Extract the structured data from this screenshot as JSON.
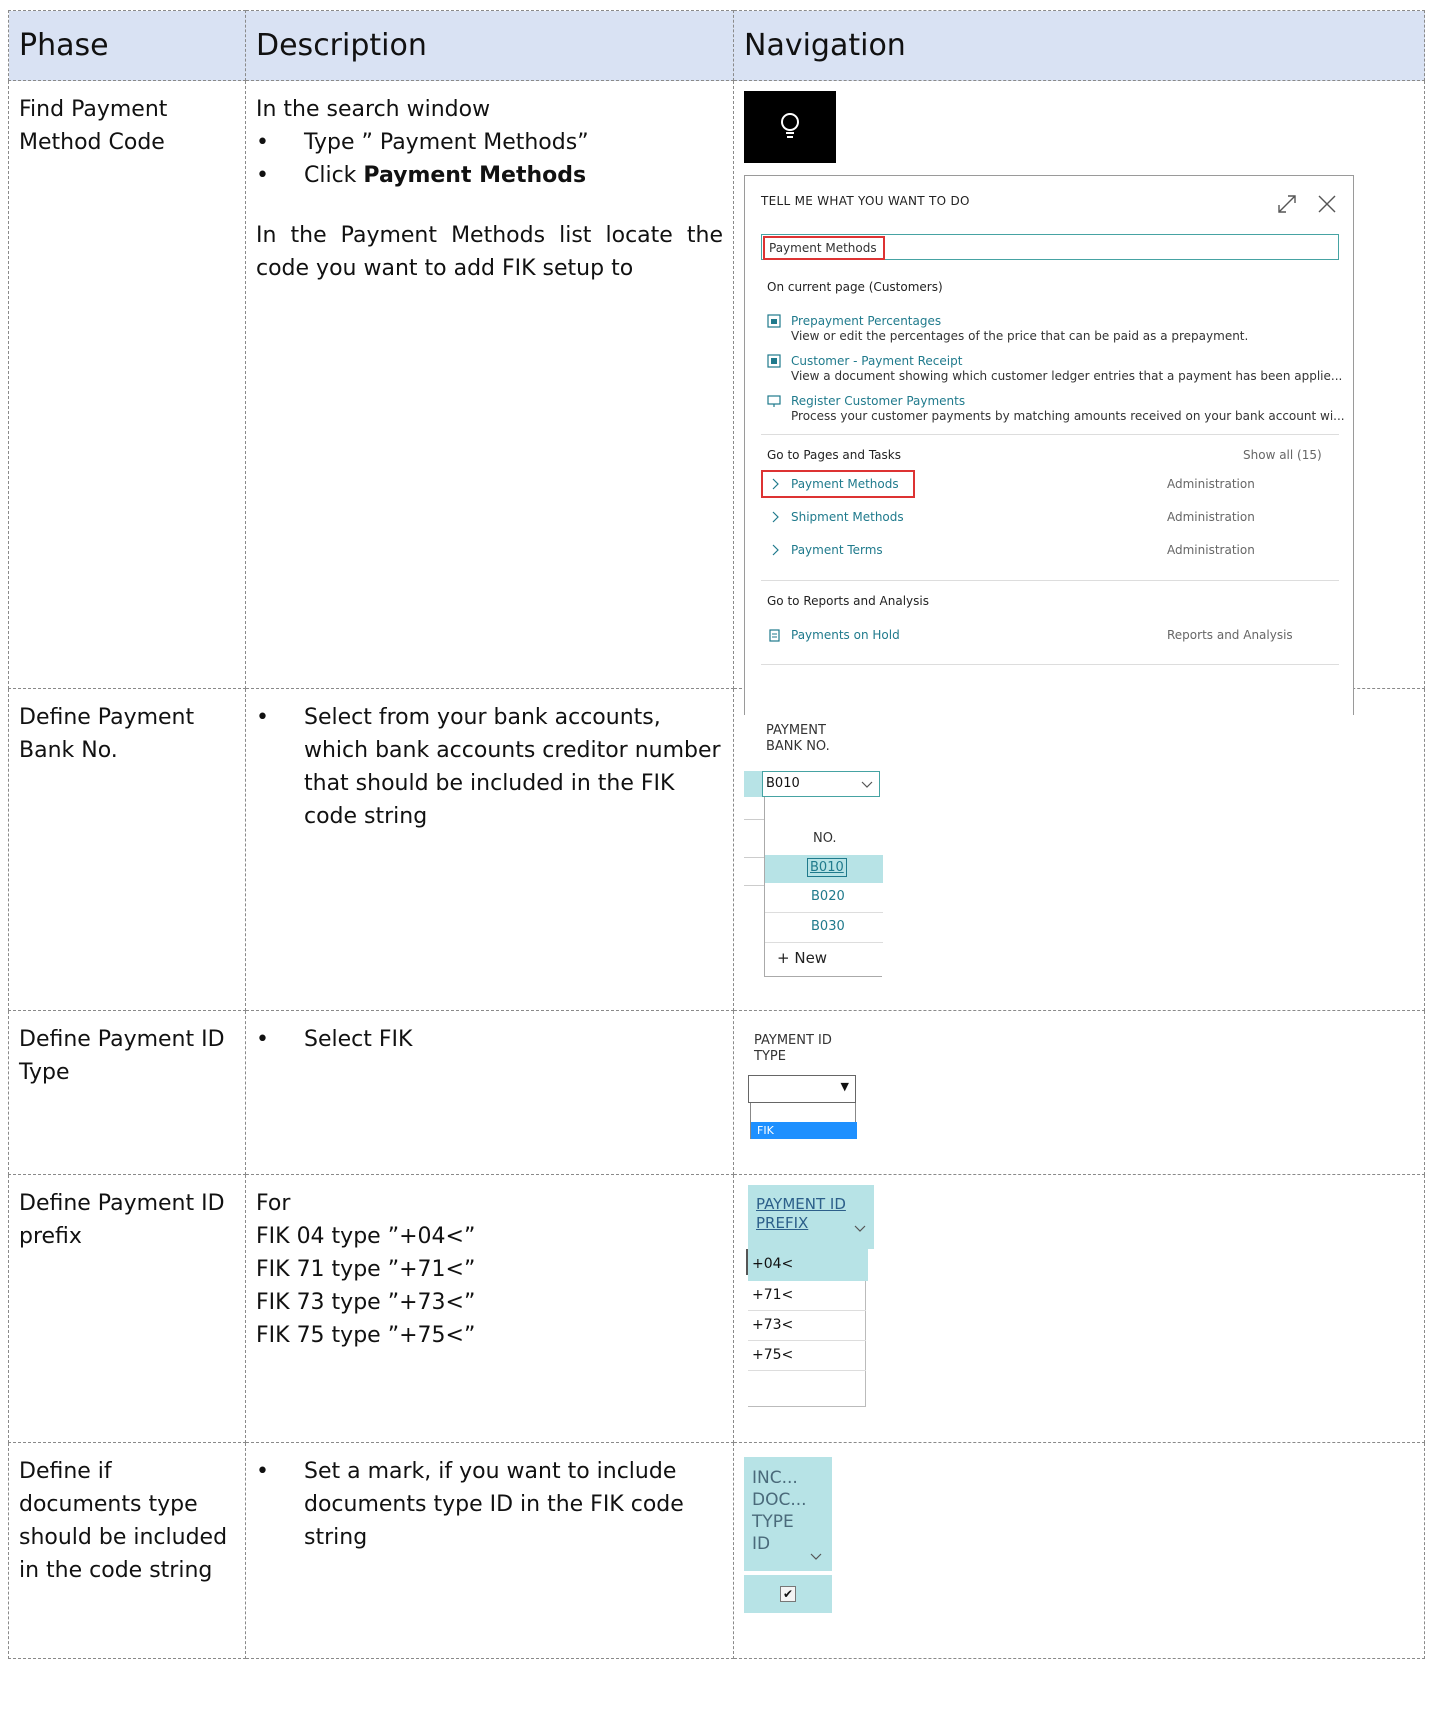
{
  "table": {
    "headers": {
      "phase": "Phase",
      "description": "Description",
      "navigation": "Navigation"
    },
    "rows": [
      {
        "phase": "Find Payment Method Code",
        "intro": "In the search window",
        "bullets": [
          "Type ” Payment Methods”"
        ],
        "bullet_click_prefix": "Click ",
        "bullet_click_bold": "Payment Methods",
        "para": "In the Payment Methods list locate the code you want to add FIK setup to"
      },
      {
        "phase": "Define Payment Bank No.",
        "bullets": [
          "Select from your bank accounts, which bank accounts creditor number that should be included in the FIK code string"
        ]
      },
      {
        "phase": "Define Payment ID Type",
        "bullets": [
          "Select FIK"
        ]
      },
      {
        "phase": "Define Payment ID prefix",
        "lines": [
          "For",
          "FIK 04 type ”+04<”",
          "FIK 71 type ”+71<”",
          "FIK 73 type ”+73<”",
          "FIK 75 type ”+75<”"
        ]
      },
      {
        "phase": "Define if documents type should be included in the code string",
        "bullets": [
          "Set a mark, if you want to include documents type ID in the FIK code string"
        ]
      }
    ]
  },
  "search_panel": {
    "title": "TELL ME WHAT YOU WANT TO DO",
    "search_value": "Payment Methods",
    "section_current": "On current page (Customers)",
    "current_items": [
      {
        "title": "Prepayment Percentages",
        "desc": "View or edit the percentages of the price that can be paid as a prepayment."
      },
      {
        "title": "Customer - Payment Receipt",
        "desc": "View a document showing which customer ledger entries that a payment has been applie..."
      },
      {
        "title": "Register Customer Payments",
        "desc": "Process your customer payments by matching amounts received on your bank account wi..."
      }
    ],
    "section_pages": "Go to Pages and Tasks",
    "show_all": "Show all (15)",
    "page_items": [
      {
        "title": "Payment Methods",
        "category": "Administration"
      },
      {
        "title": "Shipment Methods",
        "category": "Administration"
      },
      {
        "title": "Payment Terms",
        "category": "Administration"
      }
    ],
    "section_reports": "Go to Reports and Analysis",
    "report_items": [
      {
        "title": "Payments on Hold",
        "category": "Reports and Analysis"
      }
    ]
  },
  "bank_widget": {
    "label_line1": "PAYMENT",
    "label_line2": "BANK NO.",
    "value": "B010",
    "col_header": "NO.",
    "options": [
      "B010",
      "B020",
      "B030"
    ],
    "new_label": "New"
  },
  "idtype_widget": {
    "label_line1": "PAYMENT ID",
    "label_line2": "TYPE",
    "option": "FIK"
  },
  "prefix_widget": {
    "label_line1": "PAYMENT ID",
    "label_line2": "PREFIX",
    "options": [
      "+04<",
      "+71<",
      "+73<",
      "+75<"
    ]
  },
  "doctype_widget": {
    "label_lines": [
      "INC...",
      "DOC...",
      "TYPE",
      "ID"
    ]
  },
  "colors": {
    "header_bg": "#d9e2f3",
    "teal": "#b7e3e6",
    "link": "#1f7a8c",
    "highlight": "#dd3333",
    "select_blue": "#1e90ff"
  }
}
